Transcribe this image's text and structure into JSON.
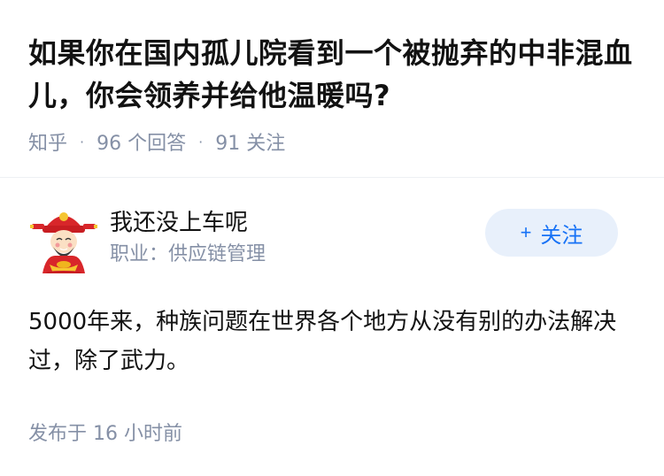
{
  "question": {
    "title": "如果你在国内孤儿院看到一个被抛弃的中非混血儿，你会领养并给他温暖吗?",
    "source": "知乎",
    "answers_count": "96 个回答",
    "followers_count": "91 关注",
    "separator": "·"
  },
  "answer": {
    "author": {
      "name": "我还没上车呢",
      "bio": "职业：供应链管理",
      "avatar_icon": "caishen-avatar-icon"
    },
    "follow_button": {
      "plus": "+",
      "label": "关注"
    },
    "content": "5000年来，种族问题在世界各个地方从没有别的办法解决过，除了武力。",
    "published": "发布于 16 小时前"
  },
  "colors": {
    "accent": "#1772f6",
    "button_bg": "#e8f0fb",
    "meta_gray": "#8590a6",
    "text": "#121212"
  }
}
